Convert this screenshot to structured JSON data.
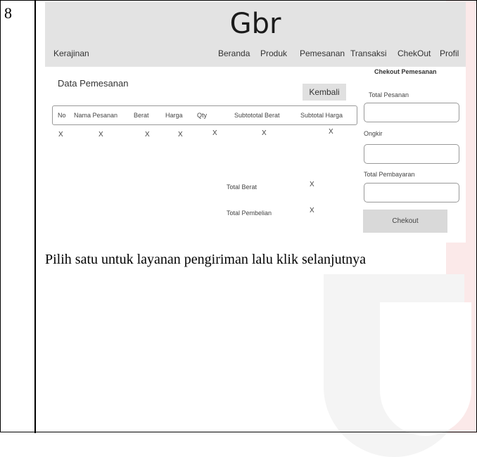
{
  "row_number": "8",
  "screenshot": {
    "logo": "Gbr",
    "brand": "Kerajinan",
    "nav": [
      "Beranda",
      "Produk",
      "Pemesanan",
      "Transaksi",
      "ChekOut",
      "Profil"
    ],
    "panel_title": "Data Pemesanan",
    "back_button": "Kembali",
    "table": {
      "headers": [
        "No",
        "Nama Pesanan",
        "Berat",
        "Harga",
        "Qty",
        "Subtototal Berat",
        "Subtotal Harga"
      ],
      "row": [
        "X",
        "X",
        "X",
        "X",
        "X",
        "X",
        "X"
      ]
    },
    "summary": {
      "total_berat_label": "Total Berat",
      "total_berat_value": "X",
      "total_pembelian_label": "Total Pembelian",
      "total_pembelian_value": "X"
    },
    "checkout": {
      "title": "Chekout Pemesanan",
      "total_pesanan_label": "Total Pesanan",
      "ongkir_label": "Ongkir",
      "total_pembayaran_label": "Total Pembayaran",
      "button": "Chekout"
    }
  },
  "caption": "Pilih satu untuk layanan pengiriman lalu klik selanjutnya"
}
